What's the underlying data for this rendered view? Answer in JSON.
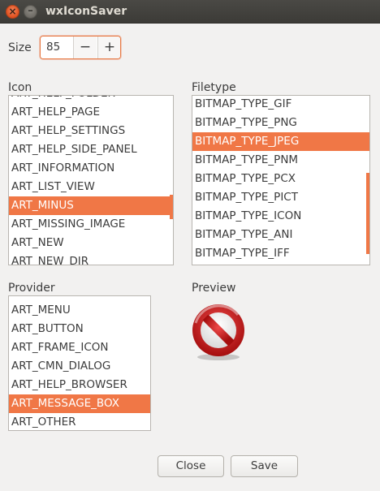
{
  "window": {
    "title": "wxIconSaver",
    "close_glyph": "×",
    "minimize_glyph": "–"
  },
  "size": {
    "label": "Size",
    "value": "85",
    "minus_label": "−",
    "plus_label": "+"
  },
  "icon": {
    "label": "Icon",
    "items": [
      "ART_HELP_FOLDER",
      "ART_HELP_PAGE",
      "ART_HELP_SETTINGS",
      "ART_HELP_SIDE_PANEL",
      "ART_INFORMATION",
      "ART_LIST_VIEW",
      "ART_MINUS",
      "ART_MISSING_IMAGE",
      "ART_NEW",
      "ART_NEW_DIR"
    ],
    "selected": "ART_MINUS"
  },
  "filetype": {
    "label": "Filetype",
    "items": [
      "BITMAP_TYPE_GIF",
      "BITMAP_TYPE_PNG",
      "BITMAP_TYPE_JPEG",
      "BITMAP_TYPE_PNM",
      "BITMAP_TYPE_PCX",
      "BITMAP_TYPE_PICT",
      "BITMAP_TYPE_ICON",
      "BITMAP_TYPE_ANI",
      "BITMAP_TYPE_IFF"
    ],
    "selected": "BITMAP_TYPE_JPEG"
  },
  "provider": {
    "label": "Provider",
    "items": [
      "ART_MENU",
      "ART_BUTTON",
      "ART_FRAME_ICON",
      "ART_CMN_DIALOG",
      "ART_HELP_BROWSER",
      "ART_MESSAGE_BOX",
      "ART_OTHER"
    ],
    "selected": "ART_MESSAGE_BOX"
  },
  "preview": {
    "label": "Preview",
    "icon": "no-entry-icon"
  },
  "buttons": {
    "close_label": "Close",
    "save_label": "Save"
  },
  "colors": {
    "accent": "#f07746",
    "titlebar": "#3c3b37",
    "background": "#f2f1f0"
  }
}
